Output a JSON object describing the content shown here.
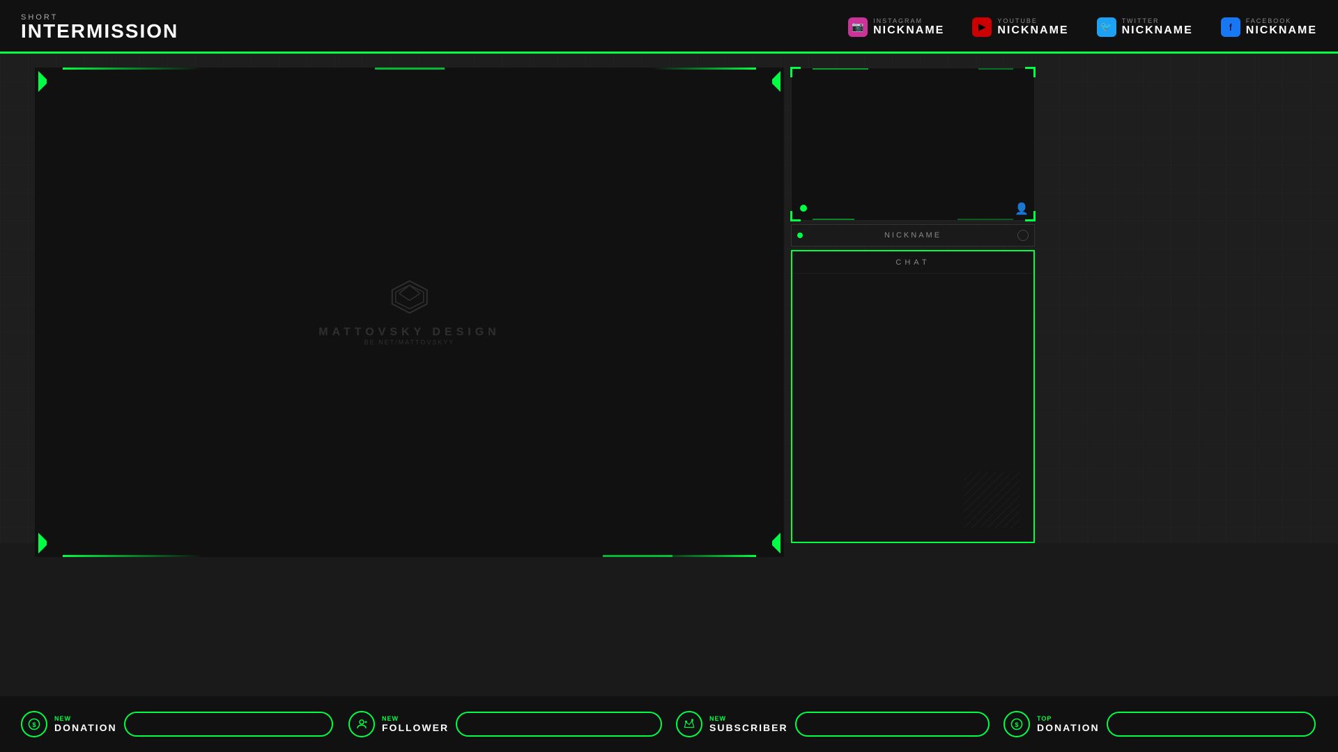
{
  "header": {
    "short_label": "SHORT",
    "title": "INTERMISSION",
    "social": [
      {
        "platform": "INSTAGRAM",
        "nickname": "NICKNAME",
        "icon": "📷",
        "class": "instagram"
      },
      {
        "platform": "YOUTUBE",
        "nickname": "NICKNAME",
        "icon": "▶",
        "class": "youtube"
      },
      {
        "platform": "TWITTER",
        "nickname": "NICKNAME",
        "icon": "🐦",
        "class": "twitter"
      },
      {
        "platform": "FACEBOOK",
        "nickname": "NICKNAME",
        "icon": "f",
        "class": "facebook"
      }
    ]
  },
  "main": {
    "watermark": {
      "text": "MATTOVSKY DESIGN",
      "subtext": "BE.NET/MATTOVSKYY"
    }
  },
  "camera": {
    "nickname": "NICKNAME"
  },
  "chat": {
    "label": "CHAT"
  },
  "bottom": {
    "items": [
      {
        "new": "NEW",
        "type": "DONATION",
        "icon": "dollar",
        "input_placeholder": ""
      },
      {
        "new": "NEW",
        "type": "FOLLOWER",
        "icon": "person",
        "input_placeholder": ""
      },
      {
        "new": "NEW",
        "type": "SUBSCRIBER",
        "icon": "crown",
        "input_placeholder": ""
      },
      {
        "new": "TOP",
        "type": "DONATION",
        "icon": "dollar",
        "input_placeholder": ""
      }
    ]
  },
  "accent_color": "#00ff44"
}
